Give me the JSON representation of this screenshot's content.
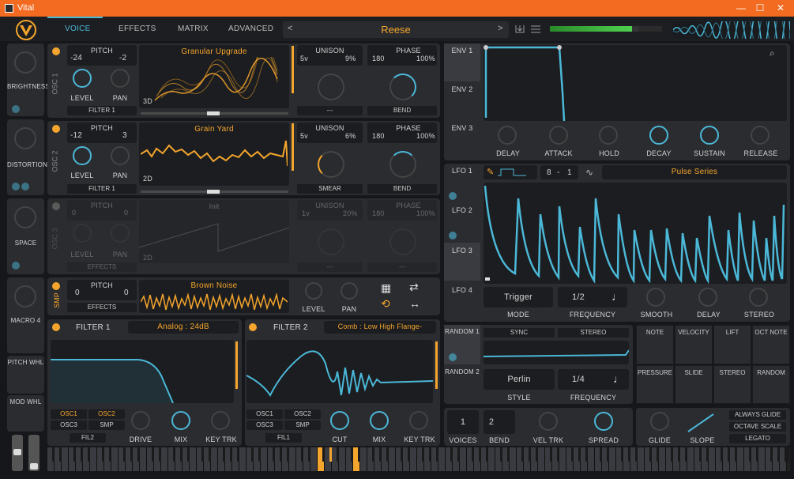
{
  "window": {
    "title": "Vital",
    "min": "—",
    "max": "☐",
    "close": "✕"
  },
  "tabs": [
    {
      "label": "VOICE"
    },
    {
      "label": "EFFECTS"
    },
    {
      "label": "MATRIX"
    },
    {
      "label": "ADVANCED"
    }
  ],
  "preset": {
    "name": "Reese"
  },
  "macros": [
    {
      "label": "BRIGHTNESS"
    },
    {
      "label": "DISTORTION"
    },
    {
      "label": "SPACE"
    },
    {
      "label": "MACRO 4"
    }
  ],
  "wheels": {
    "pitch": "PITCH WHL",
    "mod": "MOD WHL"
  },
  "osc1": {
    "label": "OSC 1",
    "pitch_label": "PITCH",
    "pitch_low": "-24",
    "pitch_high": "-2",
    "level": "LEVEL",
    "pan": "PAN",
    "dest": "FILTER 1",
    "wavetable": "Granular Upgrade",
    "dim": "3D",
    "unison": "UNISON",
    "voices": "5v",
    "detune": "9%",
    "phase_label": "PHASE",
    "phase": "180",
    "phase_amt": "100%",
    "spectral": "---",
    "distort": "BEND"
  },
  "osc2": {
    "label": "OSC 2",
    "pitch_label": "PITCH",
    "pitch_low": "-12",
    "pitch_high": "3",
    "level": "LEVEL",
    "pan": "PAN",
    "dest": "FILTER 1",
    "wavetable": "Grain Yard",
    "dim": "2D",
    "unison": "UNISON",
    "voices": "5v",
    "detune": "6%",
    "phase_label": "PHASE",
    "phase": "180",
    "phase_amt": "100%",
    "spectral": "SMEAR",
    "distort": "BEND"
  },
  "osc3": {
    "label": "OSC 3",
    "pitch_label": "PITCH",
    "pitch_low": "0",
    "pitch_high": "0",
    "level": "LEVEL",
    "pan": "PAN",
    "dest": "EFFECTS",
    "wavetable": "Init",
    "dim": "2D",
    "unison": "UNISON",
    "voices": "1v",
    "detune": "20%",
    "phase_label": "PHASE",
    "phase": "180",
    "phase_amt": "100%",
    "spectral": "---",
    "distort": "---"
  },
  "sample": {
    "label": "SMP",
    "pitch_label": "PITCH",
    "pitch_low": "0",
    "pitch_high": "0",
    "dest": "EFFECTS",
    "name": "Brown Noise",
    "level": "LEVEL",
    "pan": "PAN"
  },
  "filter1": {
    "title": "FILTER 1",
    "type": "Analog : 24dB",
    "sources": [
      "OSC1",
      "OSC2",
      "OSC3",
      "SMP",
      "FIL2"
    ],
    "drive": "DRIVE",
    "mix": "MIX",
    "keytrk": "KEY TRK"
  },
  "filter2": {
    "title": "FILTER 2",
    "type": "Comb : Low High Flange-",
    "sources": [
      "OSC1",
      "OSC2",
      "OSC3",
      "SMP",
      "FIL1"
    ],
    "cut": "CUT",
    "mix": "MIX",
    "keytrk": "KEY TRK"
  },
  "env": {
    "tabs": [
      "ENV 1",
      "ENV 2",
      "ENV 3"
    ],
    "knobs": [
      "DELAY",
      "ATTACK",
      "HOLD",
      "DECAY",
      "SUSTAIN",
      "RELEASE"
    ]
  },
  "lfo": {
    "tabs": [
      "LFO 1",
      "LFO 2",
      "LFO 3",
      "LFO 4"
    ],
    "num": "8",
    "den": "1",
    "shape": "Pulse Series",
    "trigger": "Trigger",
    "mode": "MODE",
    "freq_val": "1/2",
    "freq": "FREQUENCY",
    "smooth": "SMOOTH",
    "delay": "DELAY",
    "stereo": "STEREO"
  },
  "random": {
    "tabs": [
      "RANDOM 1",
      "RANDOM 2"
    ],
    "sync": "SYNC",
    "stereo": "STEREO",
    "style_val": "Perlin",
    "style": "STYLE",
    "freq_val": "1/4",
    "freq": "FREQUENCY"
  },
  "mod_sources": [
    "NOTE",
    "VELOCITY",
    "LIFT",
    "OCT NOTE",
    "PRESSURE",
    "SLIDE",
    "STEREO",
    "RANDOM"
  ],
  "voice": {
    "voices_val": "1",
    "voices": "VOICES",
    "bend_val": "2",
    "bend": "BEND",
    "veltrk": "VEL TRK",
    "spread": "SPREAD",
    "glide": "GLIDE",
    "slope": "SLOPE",
    "always_glide": "ALWAYS GLIDE",
    "octave_scale": "OCTAVE SCALE",
    "legato": "LEGATO"
  },
  "colors": {
    "accent": "#4bb8d8",
    "orange": "#f4a52d",
    "titlebar": "#f26b21"
  }
}
